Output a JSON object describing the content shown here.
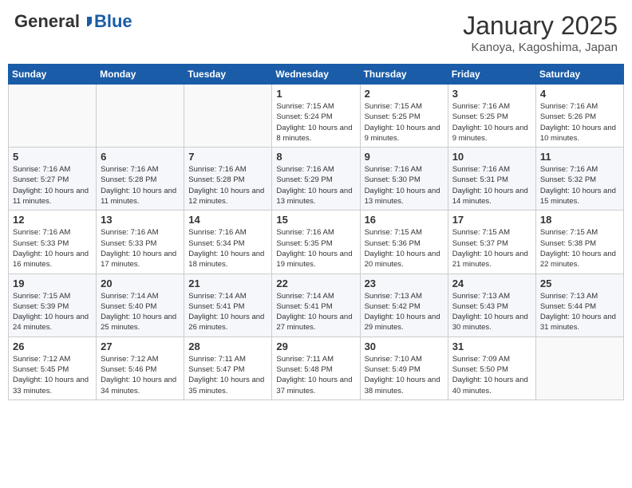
{
  "header": {
    "logo_general": "General",
    "logo_blue": "Blue",
    "month_title": "January 2025",
    "location": "Kanoya, Kagoshima, Japan"
  },
  "weekdays": [
    "Sunday",
    "Monday",
    "Tuesday",
    "Wednesday",
    "Thursday",
    "Friday",
    "Saturday"
  ],
  "weeks": [
    [
      {
        "day": "",
        "info": ""
      },
      {
        "day": "",
        "info": ""
      },
      {
        "day": "",
        "info": ""
      },
      {
        "day": "1",
        "info": "Sunrise: 7:15 AM\nSunset: 5:24 PM\nDaylight: 10 hours\nand 8 minutes."
      },
      {
        "day": "2",
        "info": "Sunrise: 7:15 AM\nSunset: 5:25 PM\nDaylight: 10 hours\nand 9 minutes."
      },
      {
        "day": "3",
        "info": "Sunrise: 7:16 AM\nSunset: 5:25 PM\nDaylight: 10 hours\nand 9 minutes."
      },
      {
        "day": "4",
        "info": "Sunrise: 7:16 AM\nSunset: 5:26 PM\nDaylight: 10 hours\nand 10 minutes."
      }
    ],
    [
      {
        "day": "5",
        "info": "Sunrise: 7:16 AM\nSunset: 5:27 PM\nDaylight: 10 hours\nand 11 minutes."
      },
      {
        "day": "6",
        "info": "Sunrise: 7:16 AM\nSunset: 5:28 PM\nDaylight: 10 hours\nand 11 minutes."
      },
      {
        "day": "7",
        "info": "Sunrise: 7:16 AM\nSunset: 5:28 PM\nDaylight: 10 hours\nand 12 minutes."
      },
      {
        "day": "8",
        "info": "Sunrise: 7:16 AM\nSunset: 5:29 PM\nDaylight: 10 hours\nand 13 minutes."
      },
      {
        "day": "9",
        "info": "Sunrise: 7:16 AM\nSunset: 5:30 PM\nDaylight: 10 hours\nand 13 minutes."
      },
      {
        "day": "10",
        "info": "Sunrise: 7:16 AM\nSunset: 5:31 PM\nDaylight: 10 hours\nand 14 minutes."
      },
      {
        "day": "11",
        "info": "Sunrise: 7:16 AM\nSunset: 5:32 PM\nDaylight: 10 hours\nand 15 minutes."
      }
    ],
    [
      {
        "day": "12",
        "info": "Sunrise: 7:16 AM\nSunset: 5:33 PM\nDaylight: 10 hours\nand 16 minutes."
      },
      {
        "day": "13",
        "info": "Sunrise: 7:16 AM\nSunset: 5:33 PM\nDaylight: 10 hours\nand 17 minutes."
      },
      {
        "day": "14",
        "info": "Sunrise: 7:16 AM\nSunset: 5:34 PM\nDaylight: 10 hours\nand 18 minutes."
      },
      {
        "day": "15",
        "info": "Sunrise: 7:16 AM\nSunset: 5:35 PM\nDaylight: 10 hours\nand 19 minutes."
      },
      {
        "day": "16",
        "info": "Sunrise: 7:15 AM\nSunset: 5:36 PM\nDaylight: 10 hours\nand 20 minutes."
      },
      {
        "day": "17",
        "info": "Sunrise: 7:15 AM\nSunset: 5:37 PM\nDaylight: 10 hours\nand 21 minutes."
      },
      {
        "day": "18",
        "info": "Sunrise: 7:15 AM\nSunset: 5:38 PM\nDaylight: 10 hours\nand 22 minutes."
      }
    ],
    [
      {
        "day": "19",
        "info": "Sunrise: 7:15 AM\nSunset: 5:39 PM\nDaylight: 10 hours\nand 24 minutes."
      },
      {
        "day": "20",
        "info": "Sunrise: 7:14 AM\nSunset: 5:40 PM\nDaylight: 10 hours\nand 25 minutes."
      },
      {
        "day": "21",
        "info": "Sunrise: 7:14 AM\nSunset: 5:41 PM\nDaylight: 10 hours\nand 26 minutes."
      },
      {
        "day": "22",
        "info": "Sunrise: 7:14 AM\nSunset: 5:41 PM\nDaylight: 10 hours\nand 27 minutes."
      },
      {
        "day": "23",
        "info": "Sunrise: 7:13 AM\nSunset: 5:42 PM\nDaylight: 10 hours\nand 29 minutes."
      },
      {
        "day": "24",
        "info": "Sunrise: 7:13 AM\nSunset: 5:43 PM\nDaylight: 10 hours\nand 30 minutes."
      },
      {
        "day": "25",
        "info": "Sunrise: 7:13 AM\nSunset: 5:44 PM\nDaylight: 10 hours\nand 31 minutes."
      }
    ],
    [
      {
        "day": "26",
        "info": "Sunrise: 7:12 AM\nSunset: 5:45 PM\nDaylight: 10 hours\nand 33 minutes."
      },
      {
        "day": "27",
        "info": "Sunrise: 7:12 AM\nSunset: 5:46 PM\nDaylight: 10 hours\nand 34 minutes."
      },
      {
        "day": "28",
        "info": "Sunrise: 7:11 AM\nSunset: 5:47 PM\nDaylight: 10 hours\nand 35 minutes."
      },
      {
        "day": "29",
        "info": "Sunrise: 7:11 AM\nSunset: 5:48 PM\nDaylight: 10 hours\nand 37 minutes."
      },
      {
        "day": "30",
        "info": "Sunrise: 7:10 AM\nSunset: 5:49 PM\nDaylight: 10 hours\nand 38 minutes."
      },
      {
        "day": "31",
        "info": "Sunrise: 7:09 AM\nSunset: 5:50 PM\nDaylight: 10 hours\nand 40 minutes."
      },
      {
        "day": "",
        "info": ""
      }
    ]
  ]
}
